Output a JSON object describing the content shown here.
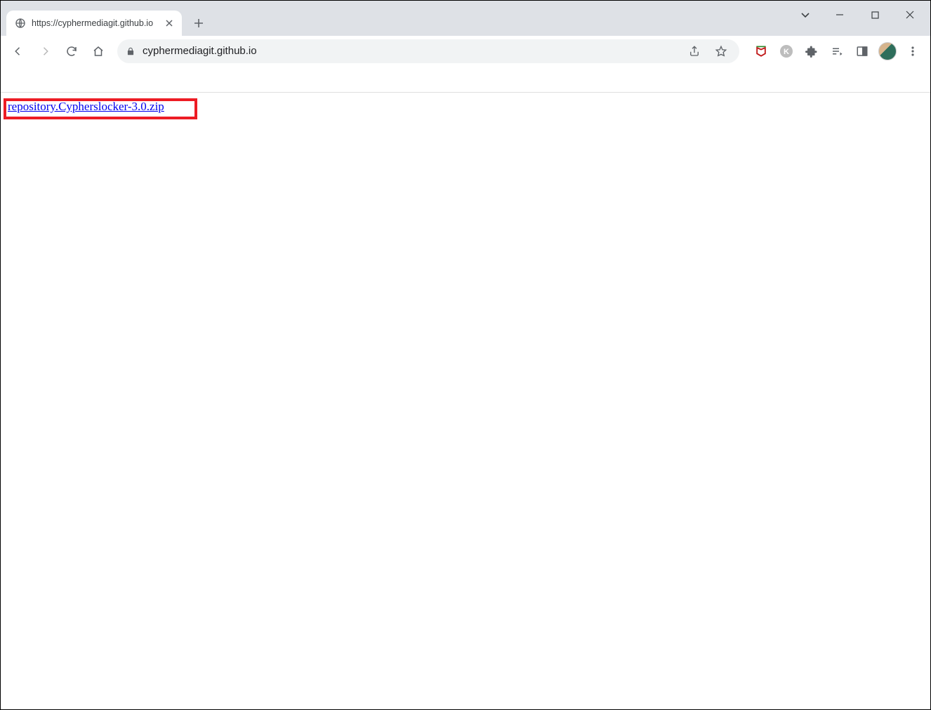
{
  "tab": {
    "title": "https://cyphermediagit.github.io"
  },
  "address_bar": {
    "url": "cyphermediagit.github.io"
  },
  "page": {
    "link_text": "repository.Cypherslocker-3.0.zip"
  },
  "icons": {
    "mcafee_color": "#c01818",
    "k_badge": "K"
  }
}
